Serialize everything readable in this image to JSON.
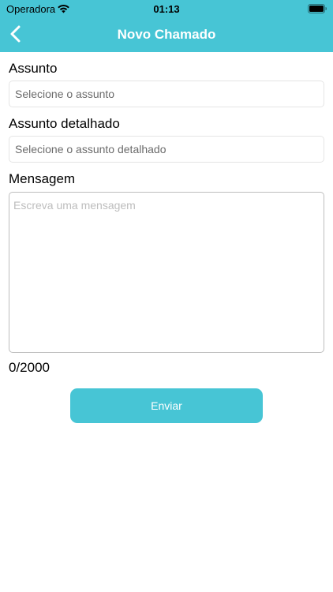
{
  "status_bar": {
    "carrier": "Operadora",
    "time": "01:13"
  },
  "nav": {
    "title": "Novo Chamado"
  },
  "form": {
    "subject_label": "Assunto",
    "subject_placeholder": "Selecione o assunto",
    "detail_label": "Assunto detalhado",
    "detail_placeholder": "Selecione o assunto detalhado",
    "message_label": "Mensagem",
    "message_placeholder": "Escreva uma mensagem",
    "counter": "0/2000",
    "submit_label": "Enviar"
  },
  "colors": {
    "accent": "#47c5d5"
  },
  "icons": {
    "back": "chevron-left-icon",
    "wifi": "wifi-icon",
    "battery": "battery-icon"
  }
}
